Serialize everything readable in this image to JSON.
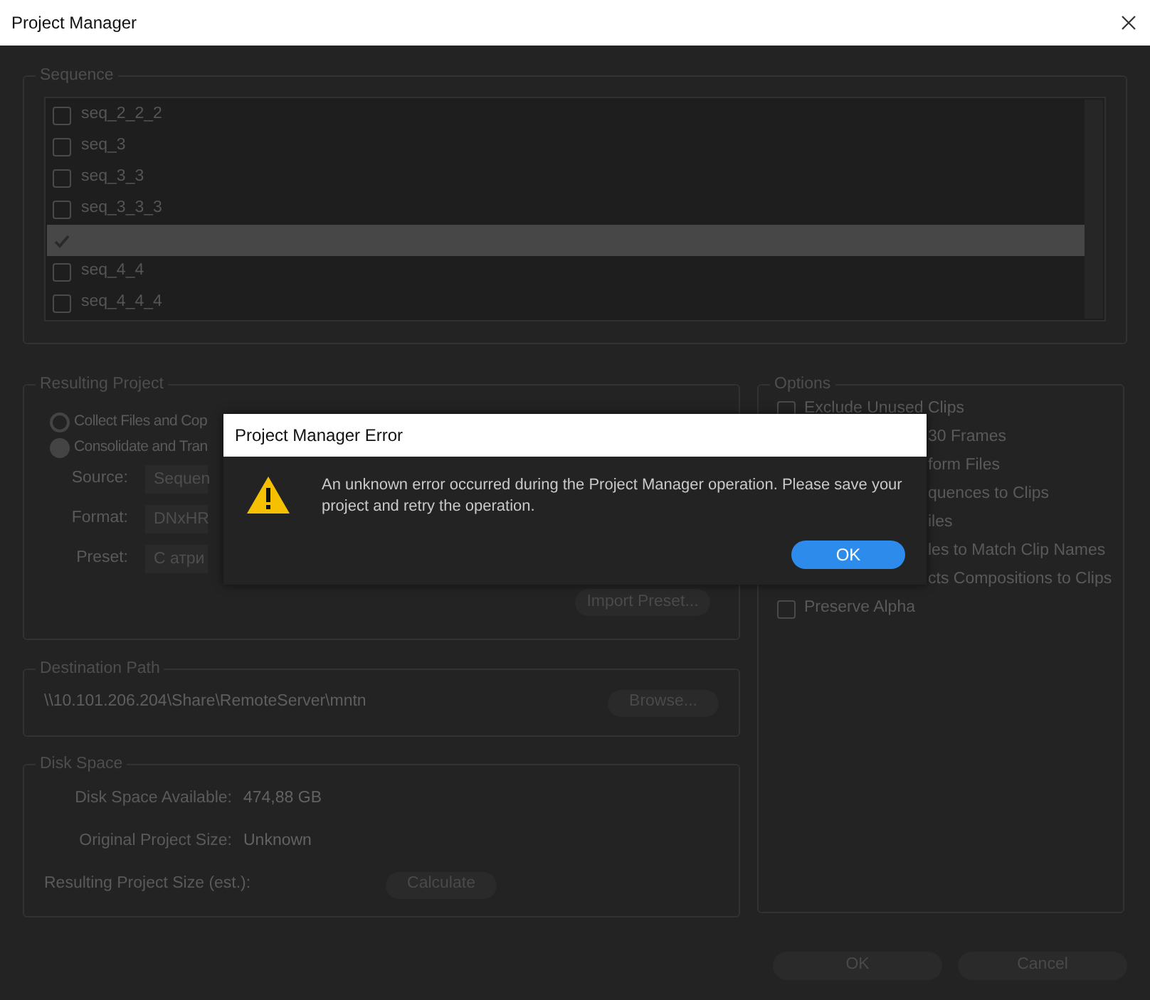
{
  "window": {
    "title": "Project Manager"
  },
  "sequence": {
    "legend": "Sequence",
    "items": [
      {
        "name": "seq_2_2_2",
        "checked": false,
        "selected": false
      },
      {
        "name": "seq_3",
        "checked": false,
        "selected": false
      },
      {
        "name": "seq_3_3",
        "checked": false,
        "selected": false
      },
      {
        "name": "seq_3_3_3",
        "checked": false,
        "selected": false
      },
      {
        "checked": true,
        "selected": true
      },
      {
        "name": "seq_4_4",
        "checked": false,
        "selected": false
      },
      {
        "name": "seq_4_4_4",
        "checked": false,
        "selected": false
      }
    ]
  },
  "resulting_project": {
    "legend": "Resulting Project",
    "modes": [
      {
        "label": "Collect Files and Cop",
        "selected": false
      },
      {
        "label": "Consolidate and Tran",
        "selected": true
      }
    ],
    "fields": [
      {
        "label": "Source:",
        "value": "Sequen"
      },
      {
        "label": "Format:",
        "value": "DNxHR"
      },
      {
        "label": "Preset:",
        "value": "С атри"
      }
    ],
    "import_button": "Import Preset..."
  },
  "options": {
    "legend": "Options",
    "items": [
      {
        "kind": "checkbox",
        "label": "Exclude Unused Clips",
        "checked": false
      },
      {
        "kind": "fragment",
        "label": "30 Frames"
      },
      {
        "kind": "fragment",
        "label": "form Files"
      },
      {
        "kind": "fragment",
        "label": "quences to Clips"
      },
      {
        "kind": "fragment",
        "label": "iles"
      },
      {
        "kind": "fragment",
        "label": "les to Match Clip Names"
      },
      {
        "kind": "fragment",
        "label": "cts Compositions to Clips"
      },
      {
        "kind": "checkbox",
        "label": "Preserve Alpha",
        "checked": false
      }
    ]
  },
  "destination": {
    "legend": "Destination Path",
    "path": "\\\\10.101.206.204\\Share\\RemoteServer\\mntn",
    "browse_button": "Browse..."
  },
  "disk_space": {
    "legend": "Disk Space",
    "rows": [
      {
        "label": "Disk Space Available:",
        "value": "474,88 GB"
      },
      {
        "label": "Original Project Size:",
        "value": "Unknown"
      },
      {
        "label": "Resulting Project Size (est.):",
        "button": "Calculate"
      }
    ]
  },
  "buttons": [
    "OK",
    "Cancel"
  ],
  "error_dialog": {
    "title": "Project Manager Error",
    "message": "An unknown error occurred during the Project Manager operation. Please save your project and retry the operation.",
    "button": "OK"
  }
}
